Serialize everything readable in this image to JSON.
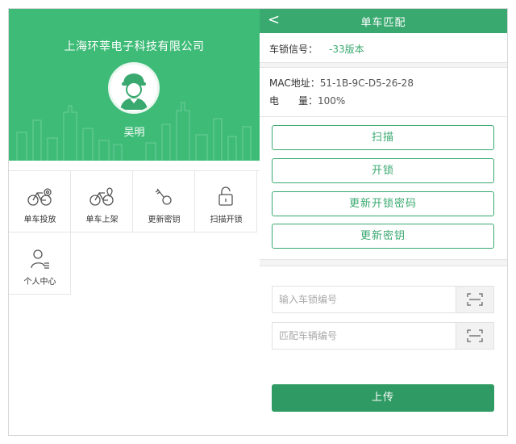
{
  "left": {
    "company": "上海环莘电子科技有限公司",
    "username": "吴明",
    "menu": [
      {
        "label": "单车投放",
        "icon": "bike-target-icon"
      },
      {
        "label": "单车上架",
        "icon": "bike-location-icon"
      },
      {
        "label": "更新密钥",
        "icon": "key-icon"
      },
      {
        "label": "扫描开锁",
        "icon": "unlock-icon"
      },
      {
        "label": "个人中心",
        "icon": "user-list-icon"
      }
    ]
  },
  "right": {
    "title": "单车匹配",
    "back": "<",
    "lock_signal_label": "车锁信号：",
    "lock_signal_value": "-33版本",
    "mac_label": "MAC地址：",
    "mac_value": "51-1B-9C-D5-26-28",
    "battery_label": "电　　量：",
    "battery_value": "100%",
    "buttons": [
      "扫描",
      "开锁",
      "更新开锁密码",
      "更新密钥"
    ],
    "lock_no_placeholder": "输入车锁编号",
    "bike_no_placeholder": "匹配车辆编号",
    "upload": "上传"
  },
  "colors": {
    "primary": "#3fbb78",
    "titlebar": "#3aa970",
    "upload": "#2f9a63"
  }
}
